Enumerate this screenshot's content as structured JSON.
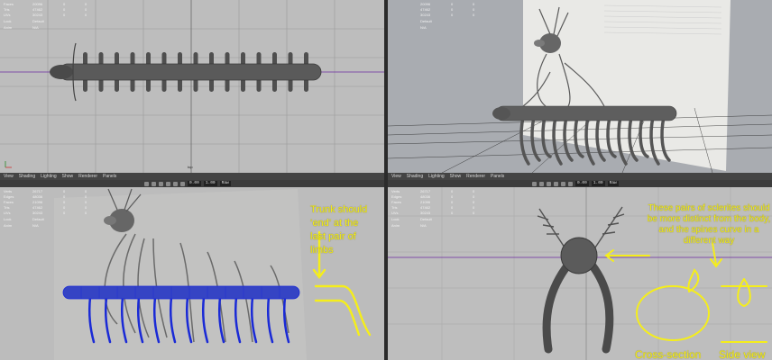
{
  "viewports": {
    "top_left": {
      "hud": {
        "rows": [
          {
            "label": "Faces",
            "value": "20096",
            "a": "0",
            "b": "0"
          },
          {
            "label": "Tris",
            "value": "47462",
            "a": "0",
            "b": "0"
          },
          {
            "label": "UVs",
            "value": "30243",
            "a": "0",
            "b": "0"
          }
        ],
        "meta": [
          {
            "label": "Lock",
            "value": "Default"
          },
          {
            "label": "Anim",
            "value": "N/A"
          }
        ]
      },
      "camera_label": "top"
    },
    "top_right": {
      "hud": {
        "rows": [
          {
            "label": "",
            "value": "20096",
            "a": "0",
            "b": "0"
          },
          {
            "label": "",
            "value": "47462",
            "a": "0",
            "b": "0"
          },
          {
            "label": "",
            "value": "30243",
            "a": "0",
            "b": "0"
          }
        ],
        "meta": [
          {
            "label": "",
            "value": "Default"
          },
          {
            "label": "",
            "value": "N/A"
          }
        ]
      }
    },
    "bottom_left": {
      "hud": {
        "rows": [
          {
            "label": "Verts",
            "value": "26717",
            "a": "0",
            "b": "0"
          },
          {
            "label": "Edges",
            "value": "48036",
            "a": "0",
            "b": "0"
          },
          {
            "label": "Faces",
            "value": "21096",
            "a": "0",
            "b": "0"
          },
          {
            "label": "Tris",
            "value": "47462",
            "a": "0",
            "b": "0"
          },
          {
            "label": "UVs",
            "value": "30243",
            "a": "0",
            "b": "0"
          }
        ],
        "meta": [
          {
            "label": "Lock",
            "value": "Default"
          },
          {
            "label": "Anim",
            "value": "N/A"
          }
        ]
      },
      "annotation": "Trunk should ‘end’ at the last pair of limbs"
    },
    "bottom_right": {
      "hud": {
        "rows": [
          {
            "label": "Verts",
            "value": "26717",
            "a": "0",
            "b": "0"
          },
          {
            "label": "Edges",
            "value": "48036",
            "a": "0",
            "b": "0"
          },
          {
            "label": "Faces",
            "value": "21096",
            "a": "0",
            "b": "0"
          },
          {
            "label": "Tris",
            "value": "47462",
            "a": "0",
            "b": "0"
          },
          {
            "label": "UVs",
            "value": "30243",
            "a": "0",
            "b": "0"
          }
        ],
        "meta": [
          {
            "label": "Lock",
            "value": "Default"
          },
          {
            "label": "Anim",
            "value": "N/A"
          }
        ]
      },
      "annotation": "These pairs of sclerites should be more distinct from the body, and the spines curve in a different way",
      "cross_section_label": "Cross-section",
      "side_view_label": "Side view"
    }
  },
  "menubar": {
    "items": [
      "View",
      "Shading",
      "Lighting",
      "Show",
      "Renderer",
      "Panels"
    ]
  },
  "toolstrip": {
    "field_a": "0.00",
    "field_b": "1.00",
    "colorspace": "Raw"
  },
  "colors": {
    "grid": "#8e8e8e",
    "annotation": "#f5ee1a",
    "wireframe": "#1a2ad6",
    "model": "#595959"
  }
}
